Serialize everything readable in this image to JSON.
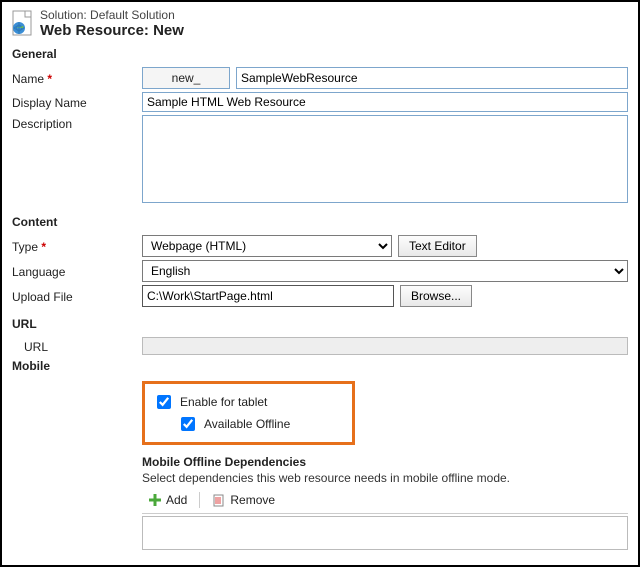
{
  "header": {
    "solution_label": "Solution:",
    "solution_name": "Default Solution",
    "page_title": "Web Resource: New"
  },
  "sections": {
    "general": "General",
    "content": "Content",
    "url": "URL",
    "mobile": "Mobile"
  },
  "labels": {
    "name": "Name",
    "display_name": "Display Name",
    "description": "Description",
    "type": "Type",
    "language": "Language",
    "upload_file": "Upload File",
    "url": "URL"
  },
  "fields": {
    "name_prefix": "new_",
    "name_value": "SampleWebResource",
    "display_name_value": "Sample HTML Web Resource",
    "description_value": "",
    "type_value": "Webpage (HTML)",
    "language_value": "English",
    "file_path": "C:\\Work\\StartPage.html",
    "url_value": ""
  },
  "buttons": {
    "text_editor": "Text Editor",
    "browse": "Browse...",
    "add": "Add",
    "remove": "Remove"
  },
  "mobile": {
    "enable_tablet": "Enable for tablet",
    "available_offline": "Available Offline",
    "deps_title": "Mobile Offline Dependencies",
    "deps_desc": "Select dependencies this web resource needs in mobile offline mode.",
    "enable_tablet_checked": true,
    "available_offline_checked": true
  }
}
